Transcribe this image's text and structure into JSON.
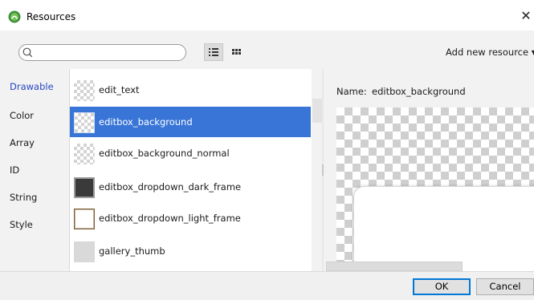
{
  "window": {
    "title": "Resources",
    "icon": "android-studio-icon",
    "close_glyph": "✕"
  },
  "toolbar": {
    "search_value": "",
    "search_placeholder": "",
    "view_list_icon": "list-view-icon",
    "view_grid_icon": "grid-view-icon",
    "add_new_resource_label": "Add new resource",
    "add_new_resource_arrow": "▼"
  },
  "categories": [
    {
      "label": "Drawable",
      "active": true
    },
    {
      "label": "Color",
      "active": false
    },
    {
      "label": "Array",
      "active": false
    },
    {
      "label": "ID",
      "active": false
    },
    {
      "label": "String",
      "active": false
    },
    {
      "label": "Style",
      "active": false
    }
  ],
  "resources": [
    {
      "name": "edit_text",
      "thumb": "checker",
      "selected": false
    },
    {
      "name": "editbox_background",
      "thumb": "checker",
      "selected": true
    },
    {
      "name": "editbox_background_normal",
      "thumb": "checker",
      "selected": false
    },
    {
      "name": "editbox_dropdown_dark_frame",
      "thumb": "dark",
      "selected": false
    },
    {
      "name": "editbox_dropdown_light_frame",
      "thumb": "light",
      "selected": false
    },
    {
      "name": "gallery_thumb",
      "thumb": "gallery",
      "selected": false
    }
  ],
  "preview": {
    "name_label": "Name:",
    "name_value": "editbox_background"
  },
  "footer": {
    "ok_label": "OK",
    "cancel_label": "Cancel"
  },
  "colors": {
    "selection": "#3875d7",
    "active_category": "#2746c4",
    "panel_bg": "#f2f2f2"
  }
}
